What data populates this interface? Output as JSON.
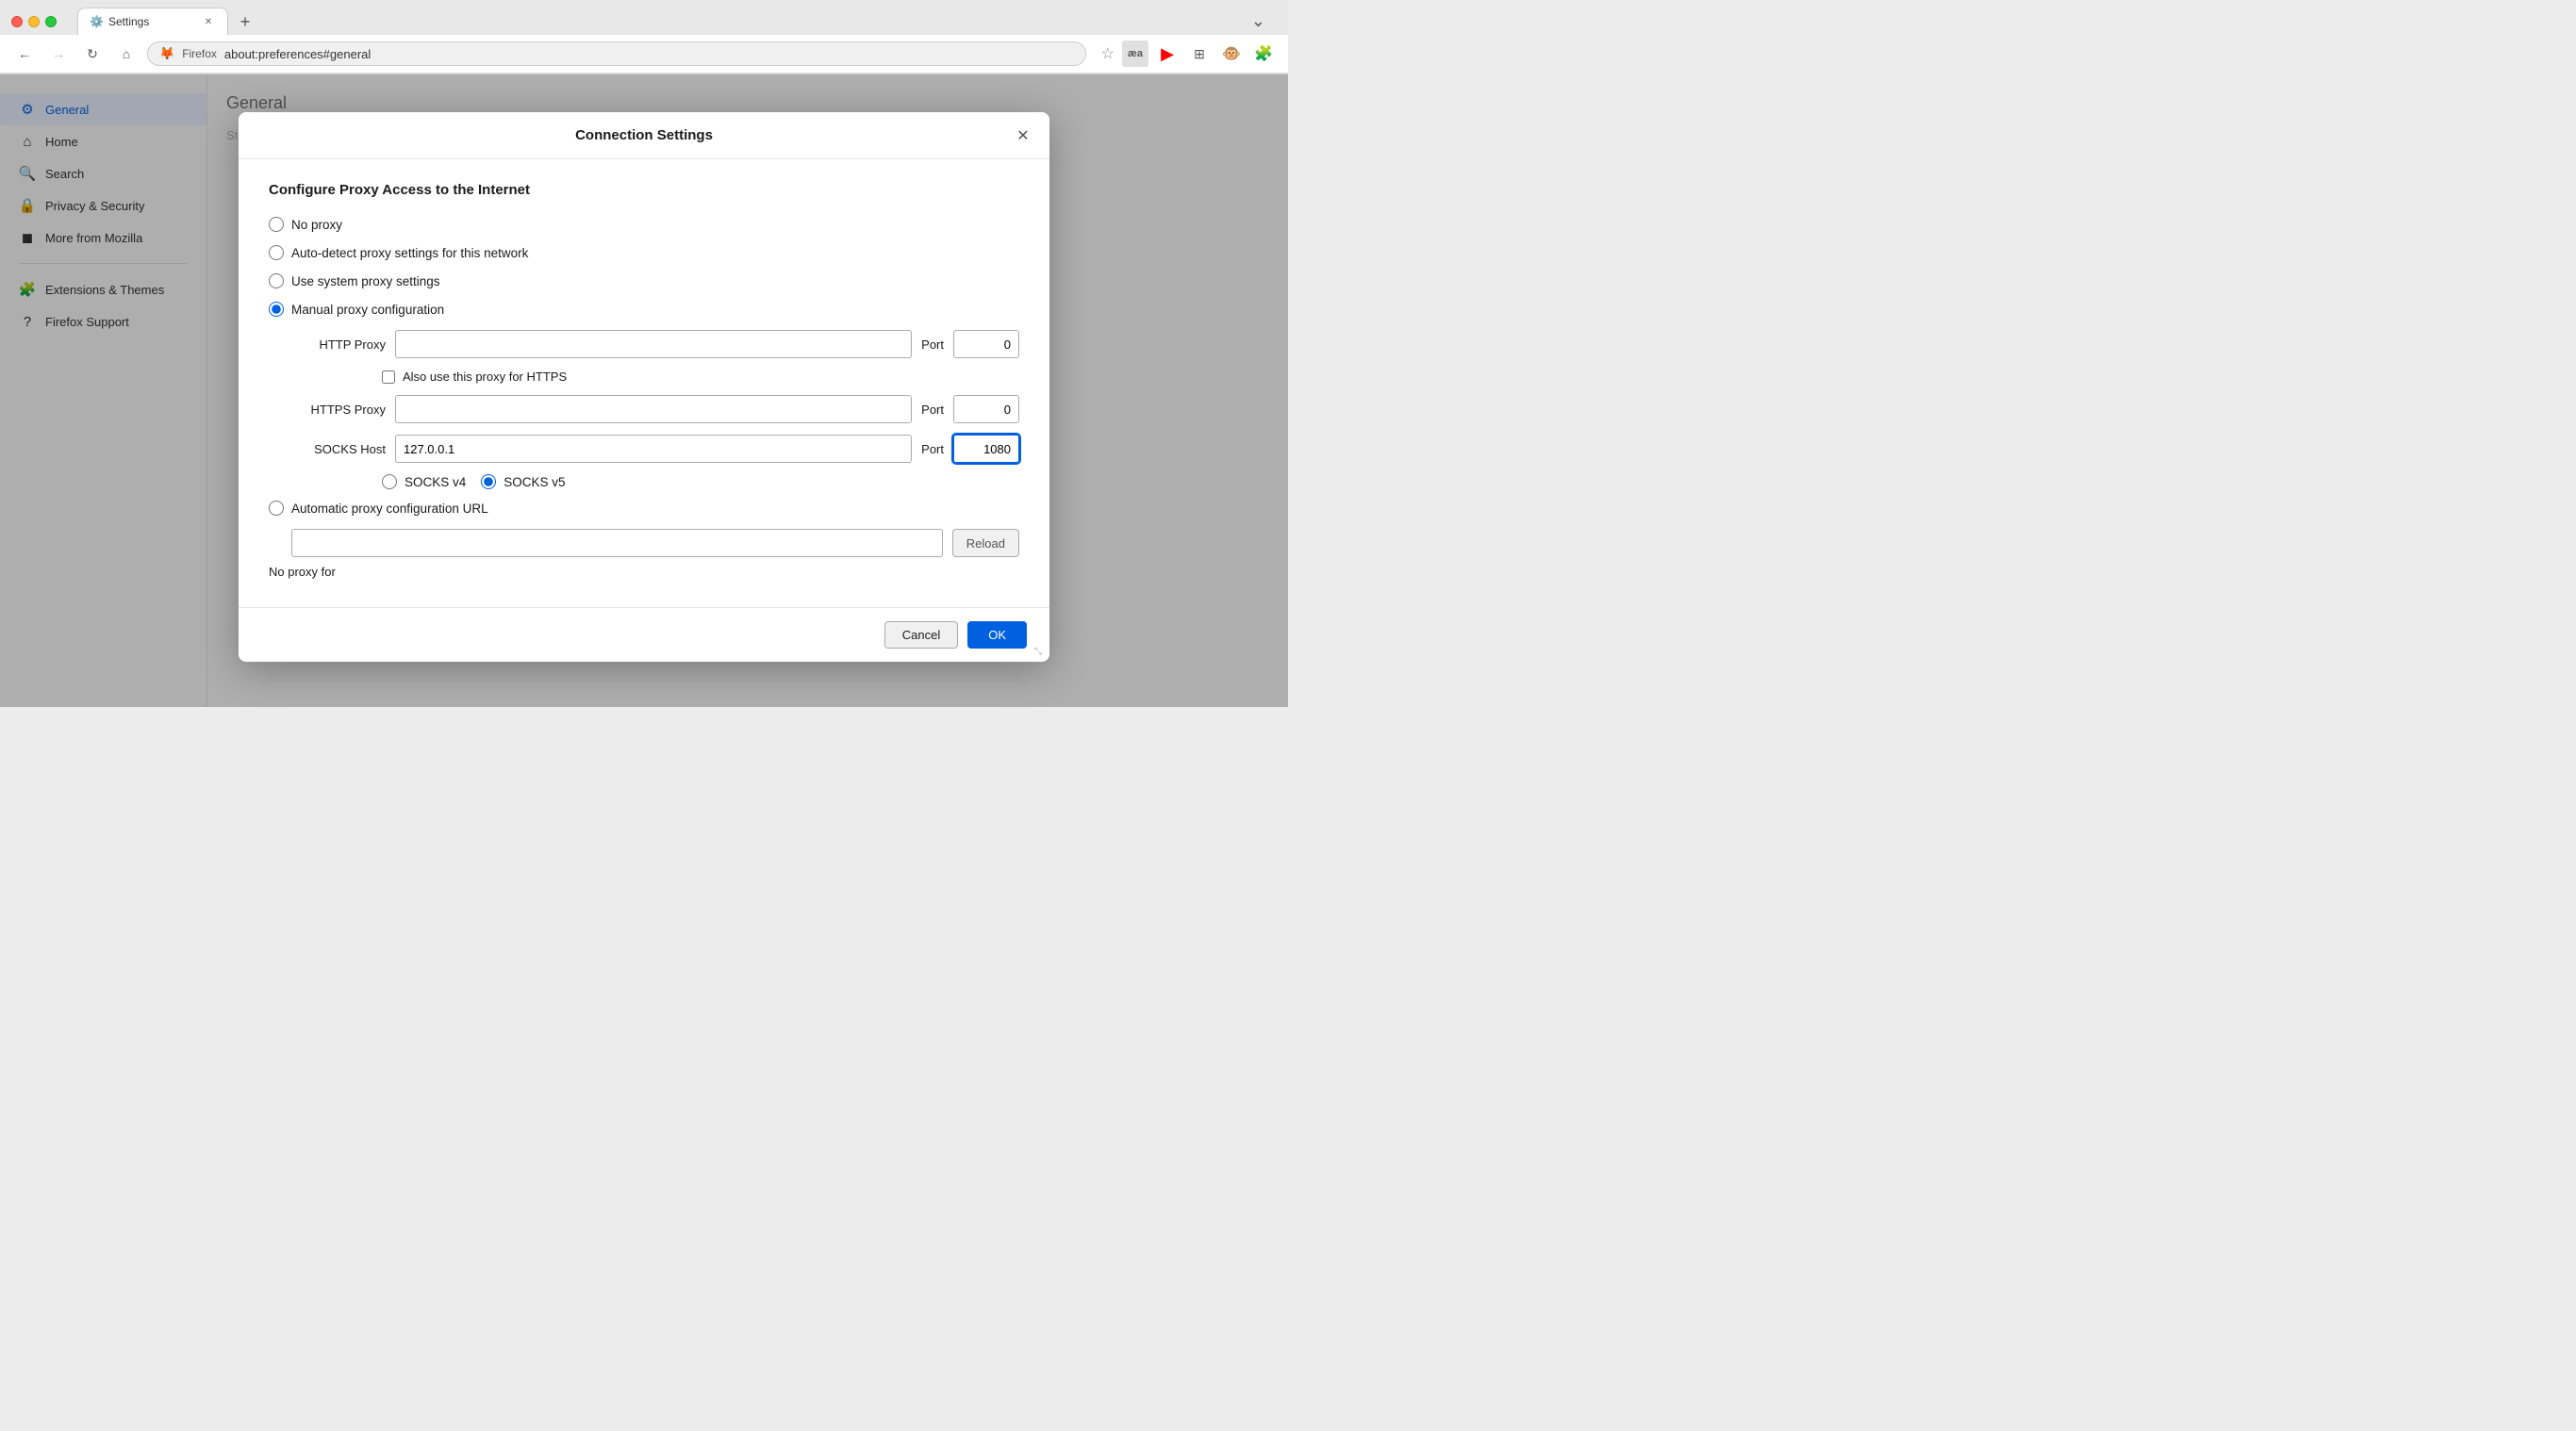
{
  "browser": {
    "title": "Firefox",
    "tab_label": "Settings",
    "address": "about:preferences#general",
    "new_tab_symbol": "+"
  },
  "sidebar": {
    "items": [
      {
        "id": "general",
        "label": "General",
        "icon": "⚙",
        "active": true
      },
      {
        "id": "home",
        "label": "Home",
        "icon": "⌂",
        "active": false
      },
      {
        "id": "search",
        "label": "Search",
        "icon": "🔍",
        "active": false
      },
      {
        "id": "privacy",
        "label": "Privacy & Security",
        "icon": "🔒",
        "active": false
      },
      {
        "id": "mozilla",
        "label": "More from Mozilla",
        "icon": "◼",
        "active": false
      }
    ],
    "bottom_items": [
      {
        "id": "extensions",
        "label": "Extensions & Themes",
        "icon": "🧩"
      },
      {
        "id": "support",
        "label": "Firefox Support",
        "icon": "?"
      }
    ]
  },
  "dialog": {
    "title": "Connection Settings",
    "section_title": "Configure Proxy Access to the Internet",
    "proxy_options": [
      {
        "id": "no_proxy",
        "label": "No proxy",
        "selected": false
      },
      {
        "id": "auto_detect",
        "label": "Auto-detect proxy settings for this network",
        "selected": false
      },
      {
        "id": "system_proxy",
        "label": "Use system proxy settings",
        "selected": false
      },
      {
        "id": "manual_proxy",
        "label": "Manual proxy configuration",
        "selected": true
      }
    ],
    "http_proxy": {
      "label": "HTTP Proxy",
      "value": "",
      "port_label": "Port",
      "port_value": "0"
    },
    "https_also_checkbox": {
      "label": "Also use this proxy for HTTPS",
      "checked": false
    },
    "https_proxy": {
      "label": "HTTPS Proxy",
      "value": "",
      "port_label": "Port",
      "port_value": "0"
    },
    "socks_host": {
      "label": "SOCKS Host",
      "value": "127.0.0.1",
      "port_label": "Port",
      "port_value": "1080"
    },
    "socks_versions": [
      {
        "id": "socks4",
        "label": "SOCKS v4",
        "selected": false
      },
      {
        "id": "socks5",
        "label": "SOCKS v5",
        "selected": true
      }
    ],
    "auto_proxy_option": {
      "label": "Automatic proxy configuration URL",
      "selected": false
    },
    "auto_proxy_url": {
      "value": "",
      "placeholder": ""
    },
    "reload_button": "Reload",
    "no_proxy_label": "No proxy for",
    "cancel_label": "Cancel",
    "ok_label": "OK"
  }
}
